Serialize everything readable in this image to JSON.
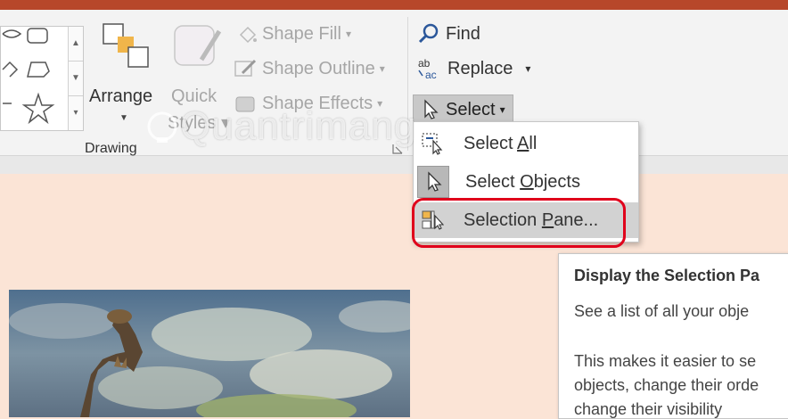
{
  "ribbon": {
    "arrange_label": "Arrange",
    "quick_styles_line1": "Quick",
    "quick_styles_line2": "Styles",
    "shape_fill": "Shape Fill",
    "shape_outline": "Shape Outline",
    "shape_effects": "Shape Effects",
    "drawing_group_label": "Drawing",
    "find": "Find",
    "replace": "Replace",
    "select": "Select"
  },
  "select_menu": {
    "items": [
      {
        "label": "Select All",
        "accelerator": "A"
      },
      {
        "label": "Select Objects",
        "accelerator": "O"
      },
      {
        "label": "Selection Pane...",
        "accelerator": "P"
      }
    ]
  },
  "tooltip": {
    "title": "Display the Selection Pa",
    "line1": "See a list of all your obje",
    "line2": "This makes it easier to se",
    "line3": "objects, change their orde",
    "line4": "change their visibility"
  },
  "watermark": "Quantrimang",
  "colors": {
    "titlebar": "#b7472a",
    "slide_bg": "#fbe4d6",
    "highlight": "#e0001b",
    "find_icon": "#2b579a"
  }
}
